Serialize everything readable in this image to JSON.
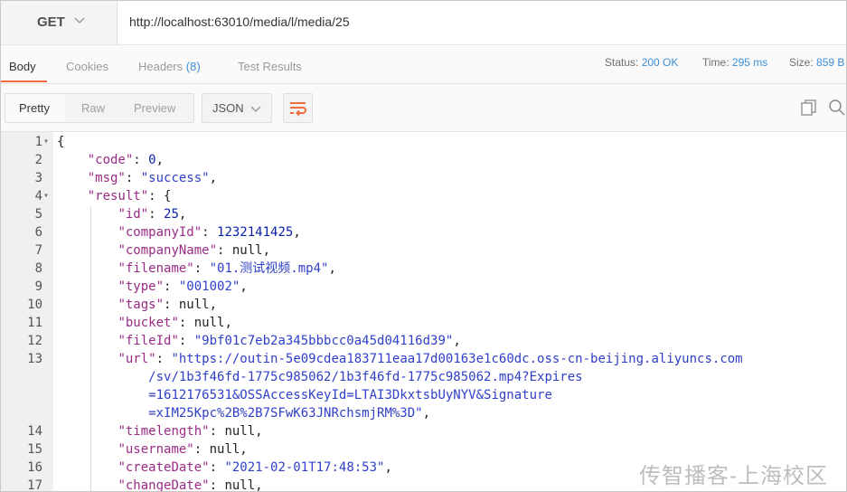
{
  "request": {
    "method": "GET",
    "url": "http://localhost:63010/media/l/media/25"
  },
  "response_tabs": [
    {
      "label": "Body"
    },
    {
      "label": "Cookies"
    },
    {
      "label": "Headers",
      "count": "(8)"
    },
    {
      "label": "Test Results"
    }
  ],
  "status_bar": {
    "status_label": "Status:",
    "status_value": "200 OK",
    "time_label": "Time:",
    "time_value": "295 ms",
    "size_label": "Size:",
    "size_value": "859 B"
  },
  "view_modes": [
    "Pretty",
    "Raw",
    "Preview"
  ],
  "format": "JSON",
  "icons": [
    "chevron-down-icon",
    "wrap-lines-icon",
    "copy-icon",
    "search-icon"
  ],
  "colors": {
    "accent": "#f26b3a",
    "link_blue": "#3d8fd6",
    "json_key": "#9a2b87",
    "json_string": "#2f3fc7"
  },
  "code_lines": [
    {
      "n": "1",
      "t": "{"
    },
    {
      "n": "2",
      "t": "    \"code\": 0,"
    },
    {
      "n": "3",
      "t": "    \"msg\": \"success\","
    },
    {
      "n": "4",
      "t": "    \"result\": {"
    },
    {
      "n": "5",
      "t": "        \"id\": 25,"
    },
    {
      "n": "6",
      "t": "        \"companyId\": 1232141425,"
    },
    {
      "n": "7",
      "t": "        \"companyName\": null,"
    },
    {
      "n": "8",
      "t": "        \"filename\": \"01.测试视频.mp4\","
    },
    {
      "n": "9",
      "t": "        \"type\": \"001002\","
    },
    {
      "n": "10",
      "t": "        \"tags\": null,"
    },
    {
      "n": "11",
      "t": "        \"bucket\": null,"
    },
    {
      "n": "12",
      "t": "        \"fileId\": \"9bf01c7eb2a345bbbcc0a45d04116d39\","
    },
    {
      "n": "13",
      "t": "        \"url\": \"https://outin-5e09cdea183711eaa17d00163e1c60dc.oss-cn-beijing.aliyuncs.com"
    },
    {
      "n": "",
      "t": "            /sv/1b3f46fd-1775c985062/1b3f46fd-1775c985062.mp4?Expires"
    },
    {
      "n": "",
      "t": "            =1612176531&OSSAccessKeyId=LTAI3DkxtsbUyNYV&Signature"
    },
    {
      "n": "",
      "t": "            =xIM25Kpc%2B%2B7SFwK63JNRchsmjRM%3D\","
    },
    {
      "n": "14",
      "t": "        \"timelength\": null,"
    },
    {
      "n": "15",
      "t": "        \"username\": null,"
    },
    {
      "n": "16",
      "t": "        \"createDate\": \"2021-02-01T17:48:53\","
    },
    {
      "n": "17",
      "t": "        \"changeDate\": null,"
    }
  ],
  "watermark": "传智播客-上海校区"
}
